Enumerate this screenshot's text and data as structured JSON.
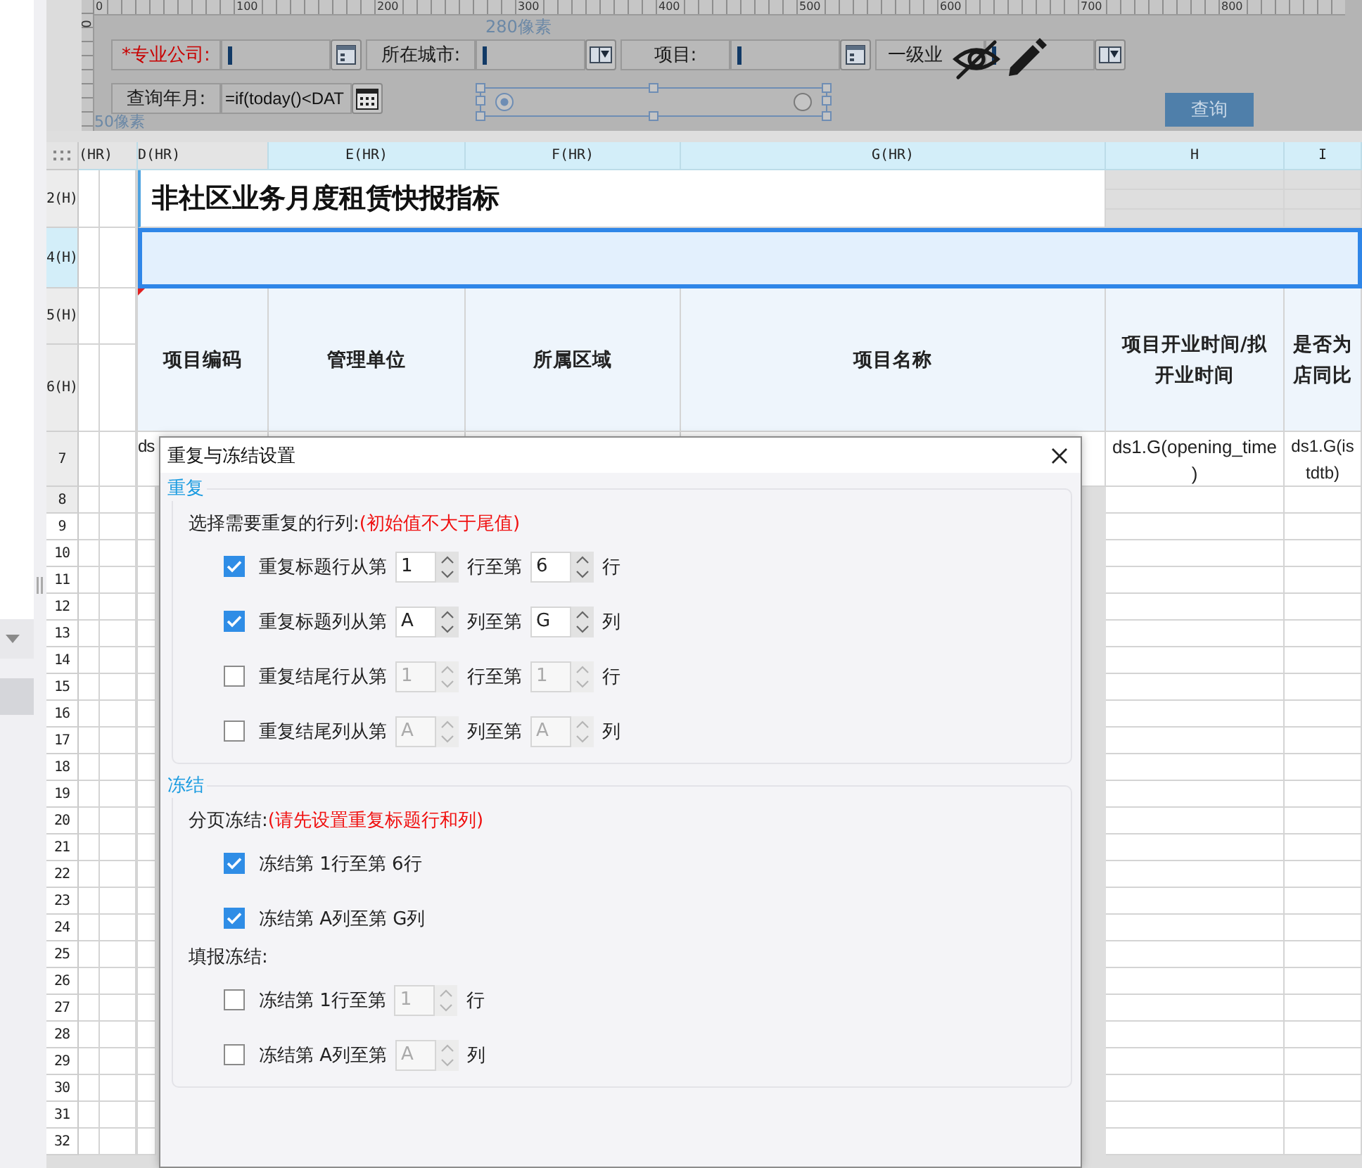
{
  "designer": {
    "vertical_ruler_mark": "0",
    "ruler_marks": [
      "0",
      "100",
      "200",
      "300",
      "400",
      "500",
      "600",
      "700",
      "800"
    ],
    "width_hint": "280像素",
    "height_hint": "50像素",
    "parameter_rows": [
      [
        {
          "kind": "label",
          "text": "*专业公司:",
          "required": true
        },
        {
          "kind": "input",
          "cursor": true
        },
        {
          "kind": "picker"
        },
        {
          "kind": "label",
          "text": "所在城市:",
          "required": false
        },
        {
          "kind": "input",
          "cursor": true
        },
        {
          "kind": "dropdown"
        },
        {
          "kind": "label",
          "text": "项目:",
          "required": false
        },
        {
          "kind": "input",
          "cursor": true
        },
        {
          "kind": "picker"
        },
        {
          "kind": "label",
          "text": "一级业",
          "required": false
        },
        {
          "kind": "input",
          "cursor": true
        },
        {
          "kind": "dropdown"
        }
      ],
      [
        {
          "kind": "label",
          "text": "查询年月:",
          "required": false
        },
        {
          "kind": "input",
          "value": "=if(today()<DAT",
          "cursor": false
        },
        {
          "kind": "calendar"
        }
      ]
    ],
    "radio_options": [
      {
        "selected": true
      },
      {
        "selected": false
      }
    ],
    "query_button": "查询"
  },
  "sheet": {
    "column_headers": [
      "(HR)",
      "D(HR)",
      "E(HR)",
      "F(HR)",
      "G(HR)",
      "H",
      "I"
    ],
    "row_headers": [
      {
        "label": "2(H)",
        "selected": false
      },
      {
        "label": "4(H)",
        "selected": true
      },
      {
        "label": "5(H)",
        "selected": false
      },
      {
        "label": "6(H)",
        "selected": false
      },
      {
        "label": "7",
        "selected": false
      },
      {
        "label": "8",
        "selected": false
      },
      {
        "label": "9",
        "selected": false
      },
      {
        "label": "10",
        "selected": false
      },
      {
        "label": "11",
        "selected": false
      },
      {
        "label": "12",
        "selected": false
      },
      {
        "label": "13",
        "selected": false
      },
      {
        "label": "14",
        "selected": false
      },
      {
        "label": "15",
        "selected": false
      },
      {
        "label": "16",
        "selected": false
      },
      {
        "label": "17",
        "selected": false
      },
      {
        "label": "18",
        "selected": false
      },
      {
        "label": "19",
        "selected": false
      },
      {
        "label": "20",
        "selected": false
      },
      {
        "label": "21",
        "selected": false
      },
      {
        "label": "22",
        "selected": false
      },
      {
        "label": "23",
        "selected": false
      },
      {
        "label": "24",
        "selected": false
      },
      {
        "label": "25",
        "selected": false
      },
      {
        "label": "26",
        "selected": false
      },
      {
        "label": "27",
        "selected": false
      },
      {
        "label": "28",
        "selected": false
      },
      {
        "label": "29",
        "selected": false
      },
      {
        "label": "30",
        "selected": false
      },
      {
        "label": "31",
        "selected": false
      },
      {
        "label": "32",
        "selected": false
      }
    ],
    "title": "非社区业务月度租赁快报指标",
    "header_cells": [
      "项目编码",
      "管理单位",
      "所属区域",
      "项目名称",
      "项目开业时间/拟开业时间",
      "是否为店同比"
    ],
    "data_cells": [
      "ds",
      "ds1.G(opening_time\n)",
      "ds1.G(is\ntdtb)"
    ]
  },
  "dialog": {
    "title": "重复与冻结设置",
    "sections": [
      {
        "title": "重复",
        "blocks": [
          {
            "label": "选择需要重复的行列:",
            "note": "(初始值不大于尾值)",
            "rows": [
              {
                "checked": true,
                "parts": [
                  {
                    "kind": "text",
                    "text": "重复标题行从第"
                  },
                  {
                    "kind": "spinner",
                    "value": "1",
                    "disabled": false
                  },
                  {
                    "kind": "text",
                    "text": "行至第"
                  },
                  {
                    "kind": "spinner",
                    "value": "6",
                    "disabled": false
                  },
                  {
                    "kind": "text",
                    "text": "行"
                  }
                ]
              },
              {
                "checked": true,
                "parts": [
                  {
                    "kind": "text",
                    "text": "重复标题列从第"
                  },
                  {
                    "kind": "spinner",
                    "value": "A",
                    "disabled": false
                  },
                  {
                    "kind": "text",
                    "text": "列至第"
                  },
                  {
                    "kind": "spinner",
                    "value": "G",
                    "disabled": false
                  },
                  {
                    "kind": "text",
                    "text": "列"
                  }
                ]
              },
              {
                "checked": false,
                "parts": [
                  {
                    "kind": "text",
                    "text": "重复结尾行从第"
                  },
                  {
                    "kind": "spinner",
                    "value": "1",
                    "disabled": true
                  },
                  {
                    "kind": "text",
                    "text": "行至第"
                  },
                  {
                    "kind": "spinner",
                    "value": "1",
                    "disabled": true
                  },
                  {
                    "kind": "text",
                    "text": "行"
                  }
                ]
              },
              {
                "checked": false,
                "parts": [
                  {
                    "kind": "text",
                    "text": "重复结尾列从第"
                  },
                  {
                    "kind": "spinner",
                    "value": "A",
                    "disabled": true
                  },
                  {
                    "kind": "text",
                    "text": "列至第"
                  },
                  {
                    "kind": "spinner",
                    "value": "A",
                    "disabled": true
                  },
                  {
                    "kind": "text",
                    "text": "列"
                  }
                ]
              }
            ]
          }
        ]
      },
      {
        "title": "冻结",
        "blocks": [
          {
            "label": "分页冻结:",
            "note": "(请先设置重复标题行和列)",
            "rows": [
              {
                "checked": true,
                "parts": [
                  {
                    "kind": "text",
                    "text": "冻结第 1行至第 6行"
                  }
                ]
              },
              {
                "checked": true,
                "parts": [
                  {
                    "kind": "text",
                    "text": "冻结第 A列至第 G列"
                  }
                ]
              }
            ]
          },
          {
            "label": "填报冻结:",
            "rows": [
              {
                "checked": false,
                "parts": [
                  {
                    "kind": "text",
                    "text": "冻结第 1行至第"
                  },
                  {
                    "kind": "spinner",
                    "value": "1",
                    "disabled": true
                  },
                  {
                    "kind": "text",
                    "text": "行"
                  }
                ]
              },
              {
                "checked": false,
                "parts": [
                  {
                    "kind": "text",
                    "text": "冻结第 A列至第"
                  },
                  {
                    "kind": "spinner",
                    "value": "A",
                    "disabled": true
                  },
                  {
                    "kind": "text",
                    "text": "列"
                  }
                ]
              }
            ]
          }
        ]
      }
    ]
  }
}
